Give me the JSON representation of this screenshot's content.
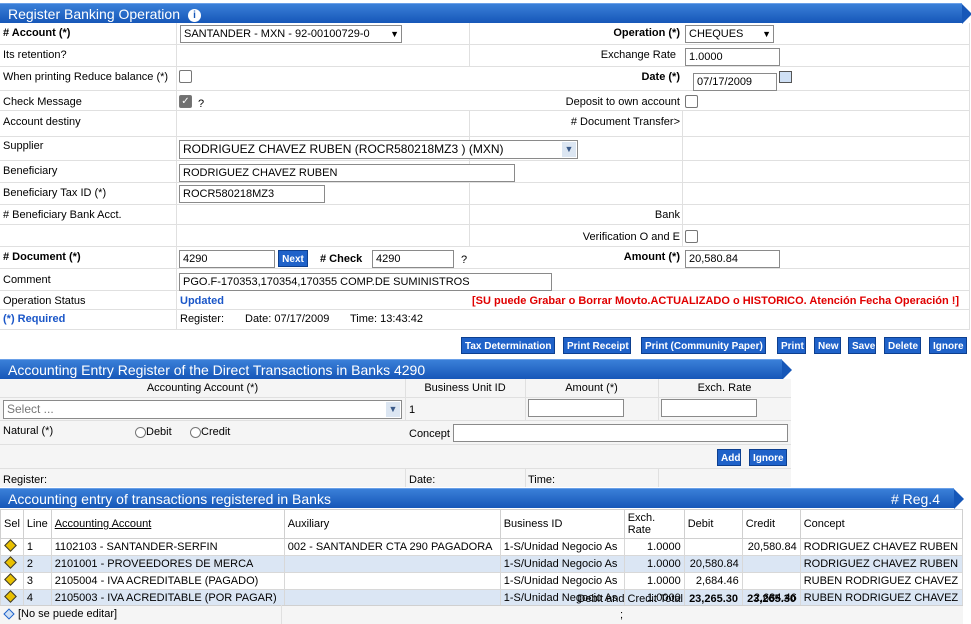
{
  "form": {
    "title": "Register Banking Operation",
    "account_label": "# Account (*)",
    "account_value": "SANTANDER - MXN - 92-00100729-0",
    "operation_label": "Operation (*)",
    "operation_value": "CHEQUES",
    "retention_label": "Its retention?",
    "exchange_rate_label": "Exchange Rate",
    "exchange_rate_value": "1.0000",
    "reduce_balance_label": "When printing Reduce balance (*)",
    "date_label": "Date (*)",
    "date_value": "07/17/2009",
    "check_message_label": "Check Message",
    "check_message_q": "?",
    "deposit_label": "Deposit to own account",
    "account_destiny_label": "Account destiny",
    "doc_transfer_label": "# Document Transfer>",
    "supplier_label": "Supplier",
    "supplier_value": "RODRIGUEZ CHAVEZ RUBEN (ROCR580218MZ3  ) (MXN)",
    "beneficiary_label": "Beneficiary",
    "beneficiary_value": "RODRIGUEZ CHAVEZ RUBEN",
    "beneficiary_tax_label": "Beneficiary Tax ID (*)",
    "beneficiary_tax_value": "ROCR580218MZ3",
    "beneficiary_bank_label": "# Beneficiary Bank Acct.",
    "bank_label": "Bank",
    "verification_label": "Verification O and E",
    "document_label": "# Document (*)",
    "document_value": "4290",
    "next_label": "Next",
    "check_label": "# Check",
    "check_value": "4290",
    "check_q": "?",
    "amount_label": "Amount (*)",
    "amount_value": "20,580.84",
    "comment_label": "Comment",
    "comment_value": "PGO.F-170353,170354,170355 COMP.DE SUMINISTROS",
    "status_label": "Operation Status",
    "status_value": "Updated",
    "warning": "[SU puede Grabar o Borrar Movto.ACTUALIZADO o HISTORICO. Atención Fecha Operación !]",
    "required_note": "(*) Required",
    "register_label": "Register:",
    "register_date": "Date: 07/17/2009",
    "register_time": "Time: 13:43:42"
  },
  "actions": {
    "tax_determination": "Tax Determination",
    "print_receipt": "Print Receipt",
    "print_community": "Print (Community Paper)",
    "print": "Print",
    "new": "New",
    "save": "Save",
    "delete": "Delete",
    "ignore": "Ignore"
  },
  "entry": {
    "title": "Accounting Entry Register of the Direct Transactions in Banks 4290",
    "col_account": "Accounting Account (*)",
    "col_bu": "Business Unit ID",
    "col_amount": "Amount (*)",
    "col_rate": "Exch. Rate",
    "select_placeholder": "Select ...",
    "bu_value": "1",
    "natural_label": "Natural (*)",
    "debit_label": "Debit",
    "credit_label": "Credit",
    "concept_label": "Concept",
    "add_label": "Add",
    "ignore_label": "Ignore",
    "register_label": "Register:",
    "date_label": "Date:",
    "time_label": "Time:"
  },
  "grid": {
    "title": "Accounting entry of transactions registered in Banks",
    "reg_count": "# Reg.4",
    "columns": [
      "Sel",
      "Line",
      "Accounting Account",
      "Auxiliary",
      "Business ID",
      "Exch. Rate",
      "Debit",
      "Credit",
      "Concept"
    ],
    "rows": [
      {
        "line": "1",
        "account": "1102103 - SANTANDER-SERFIN",
        "aux": "002 - SANTANDER CTA 290 PAGADORA",
        "bu": "1-S/Unidad Negocio As",
        "rate": "1.0000",
        "debit": "",
        "credit": "20,580.84",
        "concept": "RODRIGUEZ CHAVEZ RUBEN"
      },
      {
        "line": "2",
        "account": "2101001 - PROVEEDORES DE MERCA",
        "aux": "",
        "bu": "1-S/Unidad Negocio As",
        "rate": "1.0000",
        "debit": "20,580.84",
        "credit": "",
        "concept": "RODRIGUEZ CHAVEZ RUBEN"
      },
      {
        "line": "3",
        "account": "2105004 - IVA ACREDITABLE (PAGADO)",
        "aux": "",
        "bu": "1-S/Unidad Negocio As",
        "rate": "1.0000",
        "debit": "2,684.46",
        "credit": "",
        "concept": "RUBEN RODRIGUEZ CHAVEZ"
      },
      {
        "line": "4",
        "account": "2105003 - IVA ACREDITABLE (POR PAGAR)",
        "aux": "",
        "bu": "1-S/Unidad Negocio As",
        "rate": "1.0000",
        "debit": "",
        "credit": "2,684.46",
        "concept": "RUBEN RODRIGUEZ CHAVEZ"
      }
    ],
    "total_label": "Debit and Credit Total",
    "total_debit": "23,265.30",
    "total_credit": "23,265.30",
    "footer_note": "[No se puede editar]",
    "footer_semi": ";"
  }
}
